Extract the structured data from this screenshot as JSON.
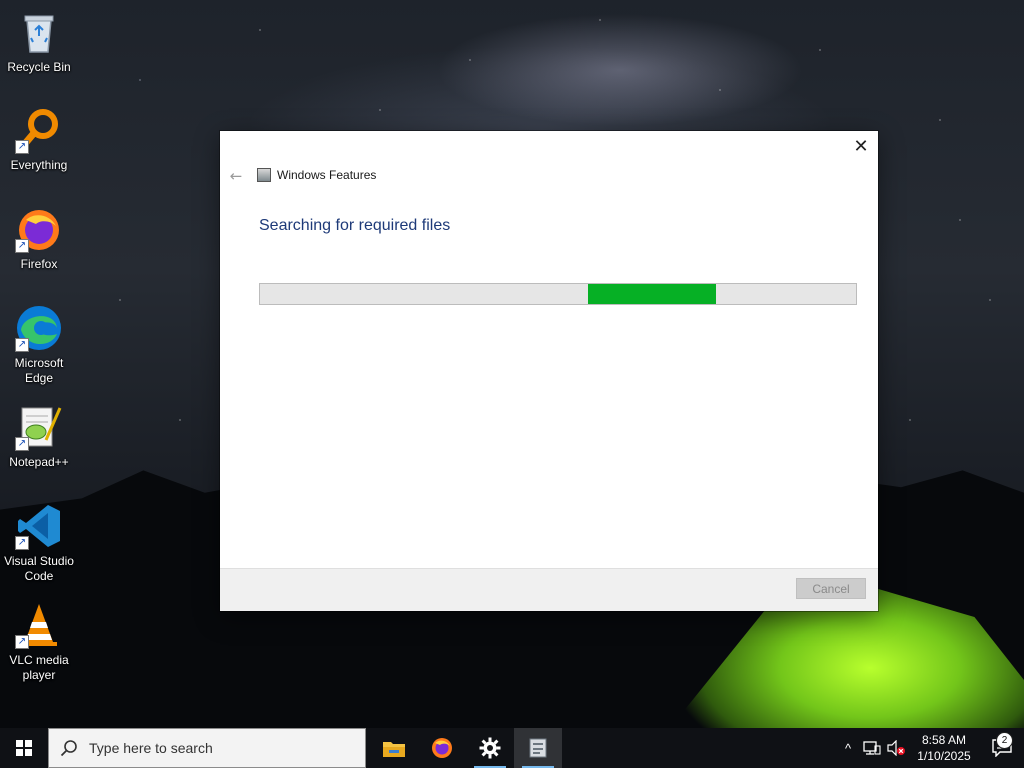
{
  "desktop": {
    "icons": [
      {
        "label": "Recycle Bin",
        "icon": "recycle-bin-icon"
      },
      {
        "label": "Everything",
        "icon": "everything-search-icon"
      },
      {
        "label": "Firefox",
        "icon": "firefox-icon"
      },
      {
        "label": "Microsoft Edge",
        "icon": "edge-icon"
      },
      {
        "label": "Notepad++",
        "icon": "notepadpp-icon"
      },
      {
        "label": "Visual Studio Code",
        "icon": "vscode-icon"
      },
      {
        "label": "VLC media player",
        "icon": "vlc-icon"
      }
    ]
  },
  "dialog": {
    "title": "Windows Features",
    "heading": "Searching for required files",
    "progress": {
      "start": 0.55,
      "end": 0.765,
      "color": "#06b025"
    },
    "cancel_label": "Cancel",
    "close_glyph": "✕",
    "back_glyph": "←"
  },
  "taskbar": {
    "search_placeholder": "Type here to search",
    "apps": [
      {
        "icon": "file-explorer-icon"
      },
      {
        "icon": "firefox-icon"
      },
      {
        "icon": "settings-gear-icon"
      },
      {
        "icon": "windows-features-icon"
      }
    ],
    "tray": {
      "chevron": "^",
      "clock_time": "8:58 AM",
      "clock_date": "1/10/2025",
      "notification_count": "2"
    }
  },
  "colors": {
    "accent_blue": "#1e3a78",
    "progress_green": "#06b025",
    "taskbar_running": "#76b9ed"
  }
}
